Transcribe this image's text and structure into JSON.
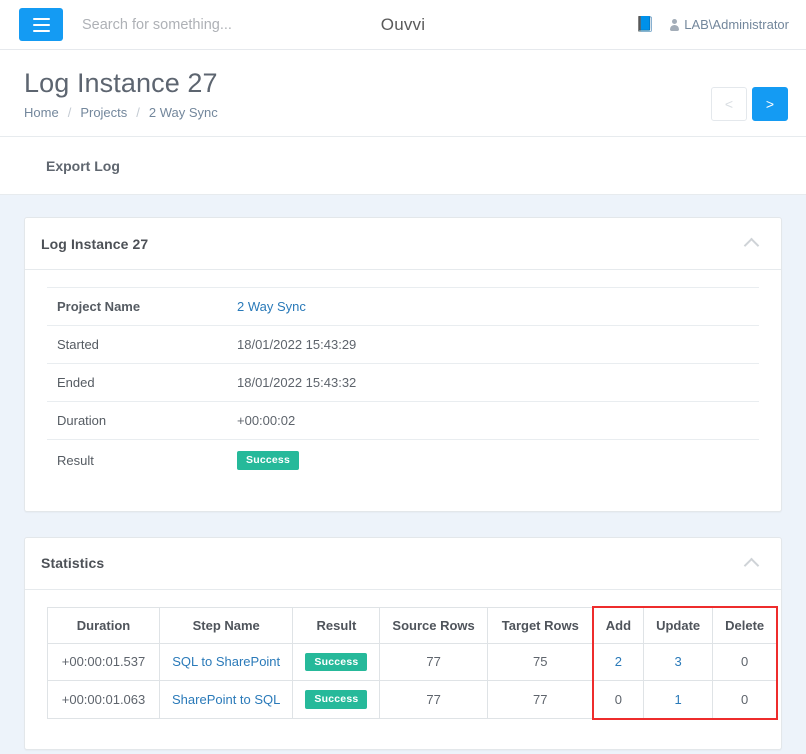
{
  "topnav": {
    "menu_icon": "hamburger-icon",
    "search_placeholder": "Search for something...",
    "search_value": "",
    "brand": "Ouvvi",
    "book_icon": "book-icon",
    "user_icon": "user-icon",
    "user_name": "LAB\\Administrator"
  },
  "page": {
    "title": "Log Instance 27",
    "breadcrumb": [
      {
        "label": "Home"
      },
      {
        "label": "Projects"
      },
      {
        "label": "2 Way Sync"
      }
    ],
    "breadcrumb_separator": "/",
    "pager": {
      "prev_label": "<",
      "next_label": ">",
      "prev_enabled": false,
      "next_enabled": true
    }
  },
  "action_bar": {
    "export_log_label": "Export Log"
  },
  "log_panel": {
    "title": "Log Instance 27",
    "collapse_icon": "chevron-up-icon",
    "rows": [
      {
        "label": "Project Name",
        "value": "2 Way Sync",
        "type": "link"
      },
      {
        "label": "Started",
        "value": "18/01/2022 15:43:29",
        "type": "text"
      },
      {
        "label": "Ended",
        "value": "18/01/2022 15:43:32",
        "type": "text"
      },
      {
        "label": "Duration",
        "value": "+00:00:02",
        "type": "text"
      },
      {
        "label": "Result",
        "value": "Success",
        "type": "badge"
      }
    ]
  },
  "statistics_panel": {
    "title": "Statistics",
    "collapse_icon": "chevron-up-icon",
    "columns": [
      "Duration",
      "Step Name",
      "Result",
      "Source Rows",
      "Target Rows",
      "Add",
      "Update",
      "Delete"
    ],
    "rows": [
      {
        "duration": "+00:00:01.537",
        "step_name": "SQL to SharePoint",
        "result": "Success",
        "source_rows": "77",
        "target_rows": "75",
        "add": "2",
        "update": "3",
        "delete": "0",
        "add_is_link": true,
        "update_is_link": true,
        "delete_is_link": false
      },
      {
        "duration": "+00:00:01.063",
        "step_name": "SharePoint to SQL",
        "result": "Success",
        "source_rows": "77",
        "target_rows": "77",
        "add": "0",
        "update": "1",
        "delete": "0",
        "add_is_link": false,
        "update_is_link": true,
        "delete_is_link": false
      }
    ],
    "highlight": {
      "present": true,
      "color": "#ee2c2c",
      "covers_columns": [
        "Add",
        "Update",
        "Delete"
      ]
    }
  },
  "colors": {
    "accent_blue": "#149bf3",
    "link_blue": "#2a7ab9",
    "success_green": "#26b99a",
    "highlight_red": "#ee2c2c",
    "page_background": "#edf3fa",
    "panel_white": "#ffffff"
  }
}
